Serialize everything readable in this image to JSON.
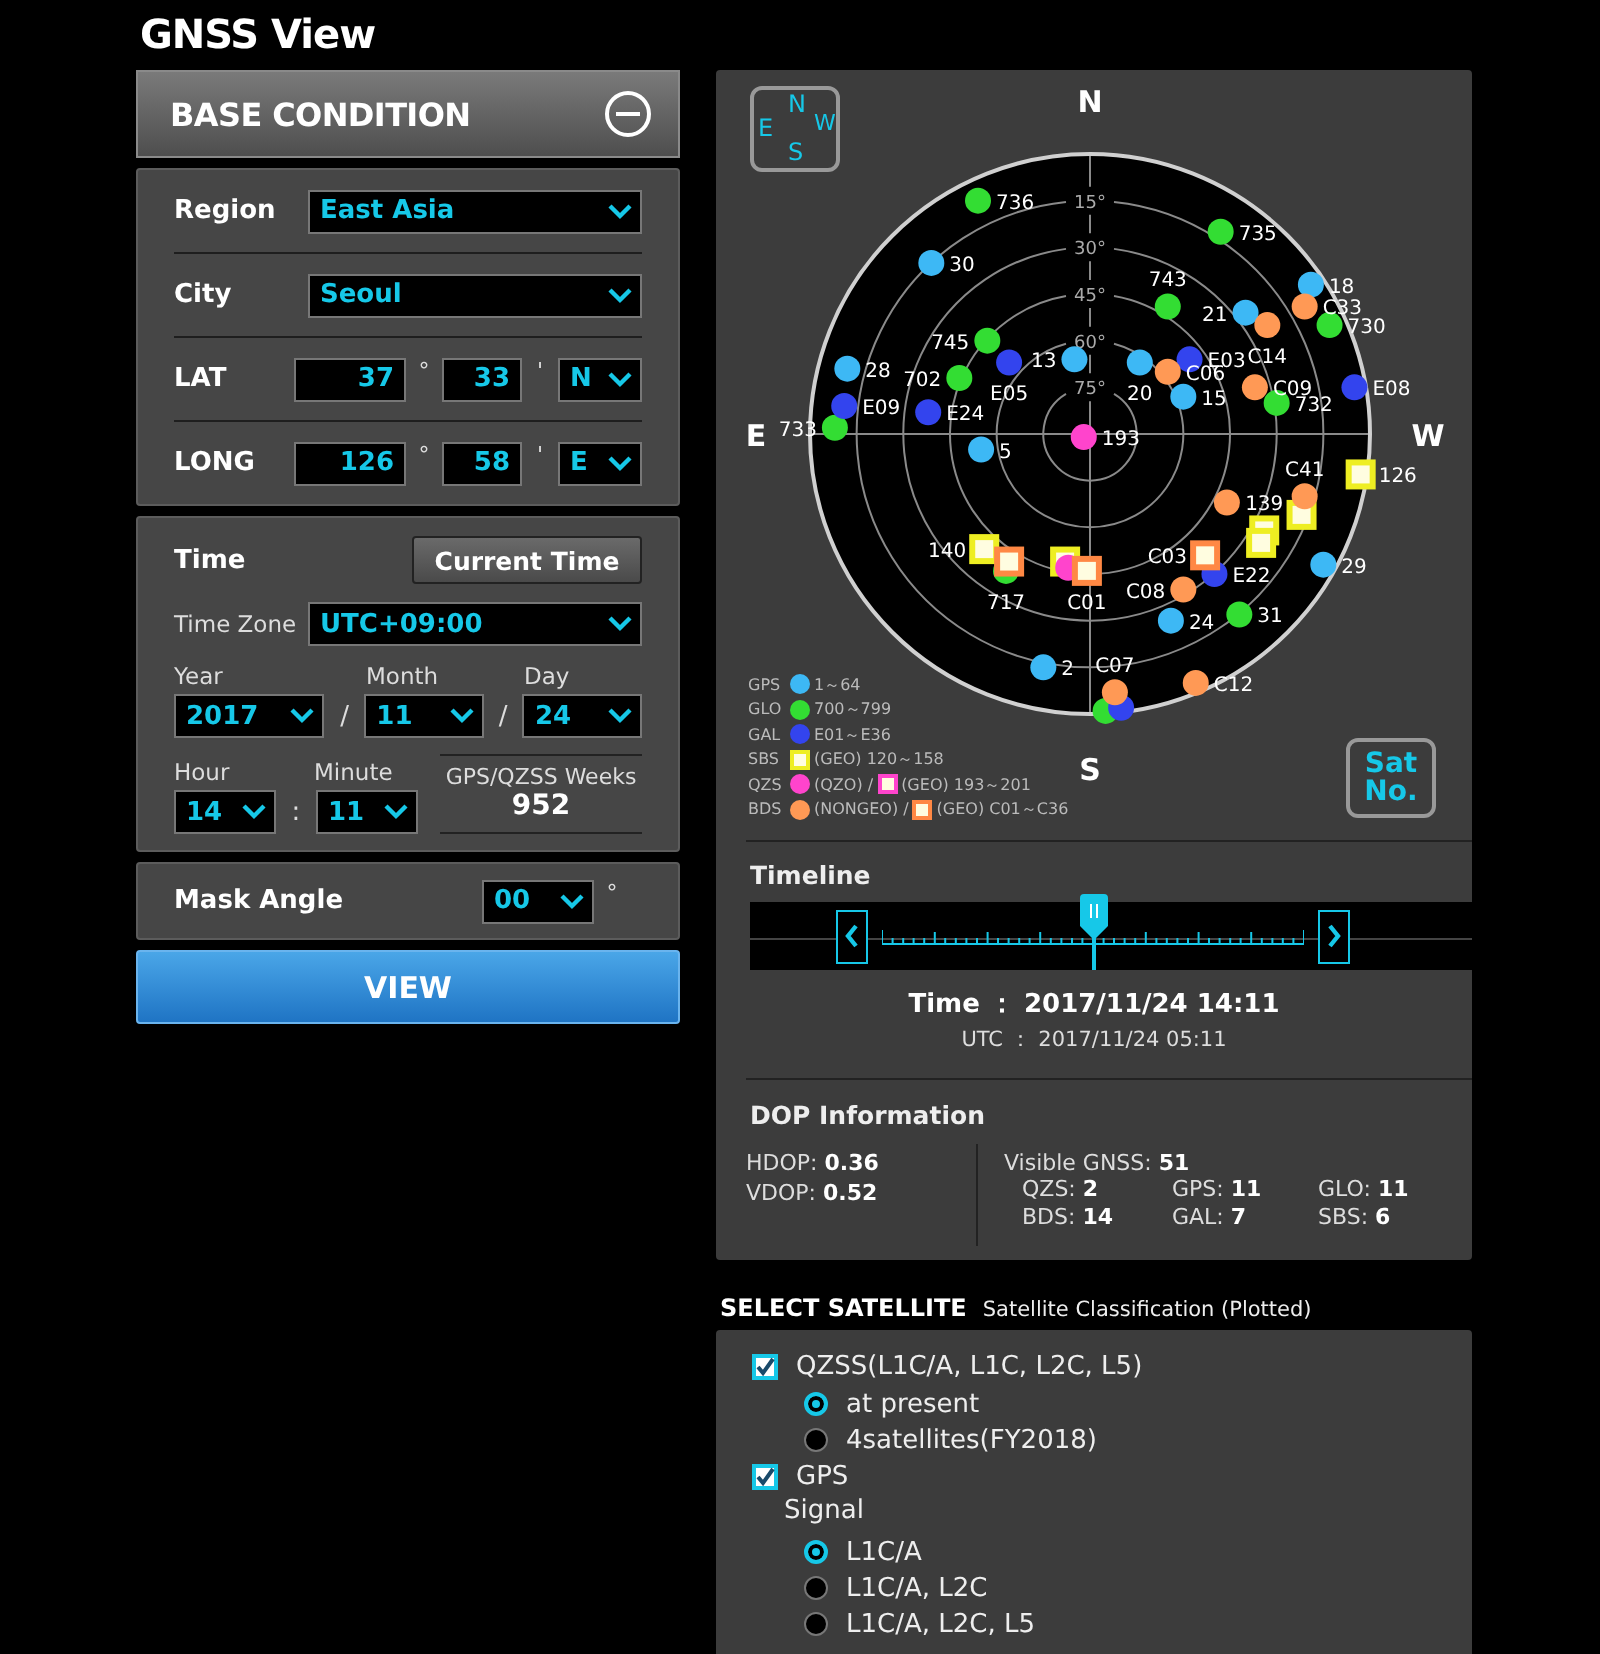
{
  "app_title": "GNSS View",
  "base_condition": {
    "title": "BASE CONDITION",
    "expanded": true,
    "region": {
      "label": "Region",
      "value": "East Asia"
    },
    "city": {
      "label": "City",
      "value": "Seoul"
    },
    "lat": {
      "label": "LAT",
      "degrees": "37",
      "degree_sign": "°",
      "minutes": "33",
      "minute_sign": "'",
      "hemisphere": "N"
    },
    "long": {
      "label": "LONG",
      "degrees": "126",
      "degree_sign": "°",
      "minutes": "58",
      "minute_sign": "'",
      "hemisphere": "E"
    },
    "time": {
      "label": "Time",
      "button": "Current Time",
      "zone_label": "Time Zone",
      "zone": "UTC+09:00",
      "year_label": "Year",
      "year": "2017",
      "month_label": "Month",
      "month": "11",
      "day_label": "Day",
      "day": "24",
      "date_sep": "/",
      "hour_label": "Hour",
      "hour": "14",
      "minute_label": "Minute",
      "minute": "11",
      "time_sep": ":",
      "weeks_label": "GPS/QZSS Weeks",
      "weeks": "952"
    },
    "mask": {
      "label": "Mask Angle",
      "value": "00",
      "unit": "°"
    },
    "view_button": "VIEW"
  },
  "sky_plot": {
    "compass_letters": {
      "n": "N",
      "e": "E",
      "s": "S",
      "w": "W"
    },
    "directions": {
      "n": "N",
      "e": "E",
      "s": "S",
      "w": "W"
    },
    "sat_no_button": "Sat No.",
    "ring_labels": [
      "15°",
      "30°",
      "45°",
      "60°",
      "75°"
    ],
    "satellites": [
      {
        "kind": "circle",
        "color": "#3db8f5",
        "label": "30"
      },
      {
        "kind": "circle",
        "color": "#3db8f5",
        "label": "18"
      },
      {
        "kind": "circle",
        "color": "#3db8f5",
        "label": "21"
      },
      {
        "kind": "circle",
        "color": "#3db8f5",
        "label": "28"
      },
      {
        "kind": "circle",
        "color": "#3db8f5",
        "label": "13"
      },
      {
        "kind": "circle",
        "color": "#3db8f5",
        "label": "20"
      },
      {
        "kind": "circle",
        "color": "#3db8f5",
        "label": "15"
      },
      {
        "kind": "circle",
        "color": "#3db8f5",
        "label": "5"
      },
      {
        "kind": "circle",
        "color": "#3db8f5",
        "label": "29"
      },
      {
        "kind": "circle",
        "color": "#3db8f5",
        "label": "24"
      },
      {
        "kind": "circle",
        "color": "#3db8f5",
        "label": "2"
      },
      {
        "kind": "circle",
        "color": "#33dd33",
        "label": "736"
      },
      {
        "kind": "circle",
        "color": "#33dd33",
        "label": "735"
      },
      {
        "kind": "circle",
        "color": "#33dd33",
        "label": "743"
      },
      {
        "kind": "circle",
        "color": "#33dd33",
        "label": "730"
      },
      {
        "kind": "circle",
        "color": "#33dd33",
        "label": "745"
      },
      {
        "kind": "circle",
        "color": "#33dd33",
        "label": "702"
      },
      {
        "kind": "circle",
        "color": "#33dd33",
        "label": "733"
      },
      {
        "kind": "circle",
        "color": "#33dd33",
        "label": "732"
      },
      {
        "kind": "circle",
        "color": "#33dd33",
        "label": "717"
      },
      {
        "kind": "circle",
        "color": "#33dd33",
        "label": "31"
      },
      {
        "kind": "circle",
        "color": "#33dd33"
      },
      {
        "kind": "circle",
        "color": "#3344ee",
        "label": "E05"
      },
      {
        "kind": "circle",
        "color": "#3344ee",
        "label": "E03"
      },
      {
        "kind": "circle",
        "color": "#3344ee",
        "label": "E08"
      },
      {
        "kind": "circle",
        "color": "#3344ee",
        "label": "E09"
      },
      {
        "kind": "circle",
        "color": "#3344ee",
        "label": "E24"
      },
      {
        "kind": "circle",
        "color": "#3344ee",
        "label": "E22"
      },
      {
        "kind": "circle",
        "color": "#3344ee"
      },
      {
        "kind": "square",
        "color": "#eeee22",
        "label": "126"
      },
      {
        "kind": "square",
        "color": "#eeee22",
        "label": "140"
      },
      {
        "kind": "square",
        "color": "#eeee22"
      },
      {
        "kind": "square",
        "color": "#eeee22",
        "label": "139"
      },
      {
        "kind": "square",
        "color": "#eeee22"
      },
      {
        "kind": "square",
        "color": "#eeee22"
      },
      {
        "kind": "circle",
        "color": "#ff44cc",
        "label": "193"
      },
      {
        "kind": "circle",
        "color": "#ff44cc"
      },
      {
        "kind": "circle",
        "color": "#ff9955",
        "label": "C33"
      },
      {
        "kind": "circle",
        "color": "#ff9955",
        "label": "C14"
      },
      {
        "kind": "circle",
        "color": "#ff9955",
        "label": "C06"
      },
      {
        "kind": "circle",
        "color": "#ff9955",
        "label": "C09"
      },
      {
        "kind": "circle",
        "color": "#ff9955",
        "label": "C41"
      },
      {
        "kind": "circle",
        "color": "#ff9955"
      },
      {
        "kind": "circle",
        "color": "#ff9955",
        "label": "C08"
      },
      {
        "kind": "circle",
        "color": "#ff9955",
        "label": "C12"
      },
      {
        "kind": "circle",
        "color": "#ff9955",
        "label": "C07"
      },
      {
        "kind": "square",
        "color": "#ff8844",
        "label": "C03"
      },
      {
        "kind": "square",
        "color": "#ff8844"
      },
      {
        "kind": "square",
        "color": "#ff8844",
        "label": "C01"
      }
    ],
    "legend": [
      {
        "system": "GPS",
        "items": [
          {
            "kind": "circle",
            "color": "#3db8f5",
            "text": "1～64"
          }
        ]
      },
      {
        "system": "GLO",
        "items": [
          {
            "kind": "circle",
            "color": "#33dd33",
            "text": "700～799"
          }
        ]
      },
      {
        "system": "GAL",
        "items": [
          {
            "kind": "circle",
            "color": "#3344ee",
            "text": "E01～E36"
          }
        ]
      },
      {
        "system": "SBS",
        "items": [
          {
            "kind": "square",
            "color": "#eeee22",
            "text": "(GEO) 120～158"
          }
        ]
      },
      {
        "system": "QZS",
        "items": [
          {
            "kind": "circle",
            "color": "#ff44cc",
            "text": "(QZO) /"
          },
          {
            "kind": "square",
            "color": "#ff44cc",
            "text": "(GEO) 193～201"
          }
        ]
      },
      {
        "system": "BDS",
        "items": [
          {
            "kind": "circle",
            "color": "#ff9955",
            "text": "(NONGEO) /"
          },
          {
            "kind": "square",
            "color": "#ff8844",
            "text": "(GEO) C01～C36"
          }
        ]
      }
    ]
  },
  "timeline": {
    "title": "Timeline",
    "level": 0.5,
    "time": "Time ： 2017/11/24 14:11",
    "utc": "UTC ： 2017/11/24 05:11"
  },
  "dop": {
    "title": "DOP Information",
    "left": [
      "HDOP: **0.36**",
      "VDOP: **0.52**"
    ],
    "visible": "Visible GNSS: **51**",
    "counts": [
      "QZS: **2**",
      "GPS: **11**",
      "GLO: **11**",
      "BDS: **14**",
      "GAL: **7**",
      "SBS: **6**"
    ]
  },
  "select_satellite": {
    "title": "SELECT SATELLITE",
    "subtitle": "Satellite Classification (Plotted)",
    "groups": [
      {
        "label": "QZSS(L1C/A, L1C, L2C, L5)",
        "checked": true,
        "options": [
          {
            "label": "at present",
            "selected": true
          },
          {
            "label": "4satellites(FY2018)",
            "selected": false
          }
        ]
      },
      {
        "label": "GPS",
        "checked": true,
        "signal_label": "Signal",
        "options": [
          {
            "label": "L1C/A",
            "selected": true
          },
          {
            "label": "L1C/A, L2C",
            "selected": false
          },
          {
            "label": "L1C/A, L2C, L5",
            "selected": false
          }
        ]
      }
    ]
  }
}
